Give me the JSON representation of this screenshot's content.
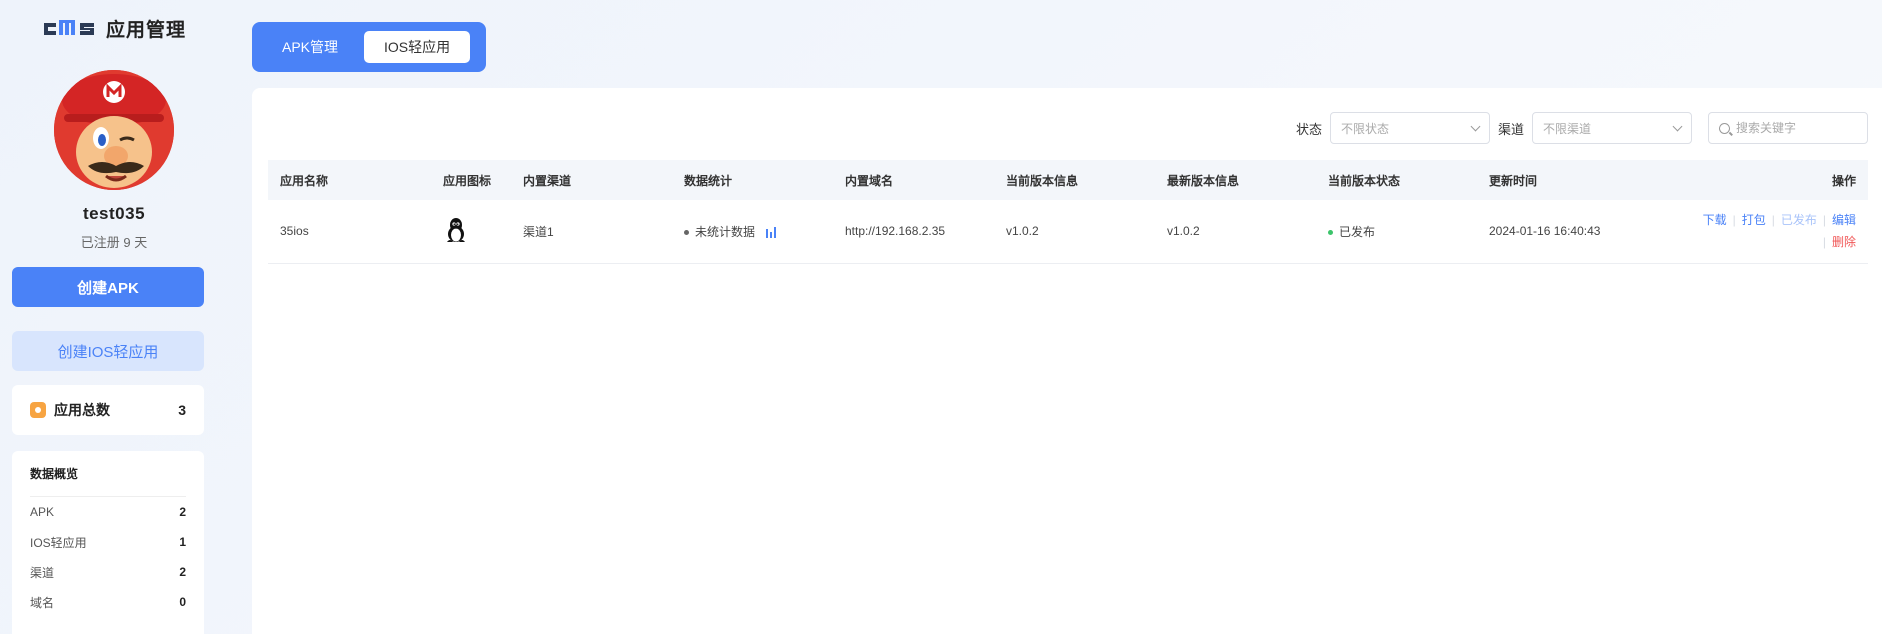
{
  "brand": {
    "logo_text": "cms",
    "title": "应用管理"
  },
  "user": {
    "name": "test035",
    "registered": "已注册 9 天"
  },
  "sidebar": {
    "create_apk": "创建APK",
    "create_ios": "创建IOS轻应用",
    "total_label": "应用总数",
    "total_count": "3",
    "stats_title": "数据概览",
    "stats": [
      {
        "label": "APK",
        "value": "2"
      },
      {
        "label": "IOS轻应用",
        "value": "1"
      },
      {
        "label": "渠道",
        "value": "2"
      },
      {
        "label": "域名",
        "value": "0"
      }
    ]
  },
  "tabs": [
    {
      "label": "APK管理",
      "active": false
    },
    {
      "label": "IOS轻应用",
      "active": true
    }
  ],
  "filters": {
    "status_label": "状态",
    "status_placeholder": "不限状态",
    "channel_label": "渠道",
    "channel_placeholder": "不限渠道",
    "search_placeholder": "搜索关键字"
  },
  "table": {
    "headers": [
      "应用名称",
      "应用图标",
      "内置渠道",
      "数据统计",
      "内置域名",
      "当前版本信息",
      "最新版本信息",
      "当前版本状态",
      "更新时间",
      "操作"
    ],
    "rows": [
      {
        "name": "35ios",
        "icon": "linux-penguin-icon",
        "channel": "渠道1",
        "stats": "未统计数据",
        "domain": "http://192.168.2.35",
        "current_version": "v1.0.2",
        "latest_version": "v1.0.2",
        "status": "已发布",
        "updated": "2024-01-16 16:40:43",
        "ops": {
          "download": "下载",
          "pack": "打包",
          "published": "已发布",
          "edit": "编辑",
          "delete": "删除"
        }
      }
    ]
  },
  "colors": {
    "primary": "#4a82f7",
    "danger": "#f05656",
    "success": "#3cc46a",
    "accent_orange": "#f7a442"
  }
}
